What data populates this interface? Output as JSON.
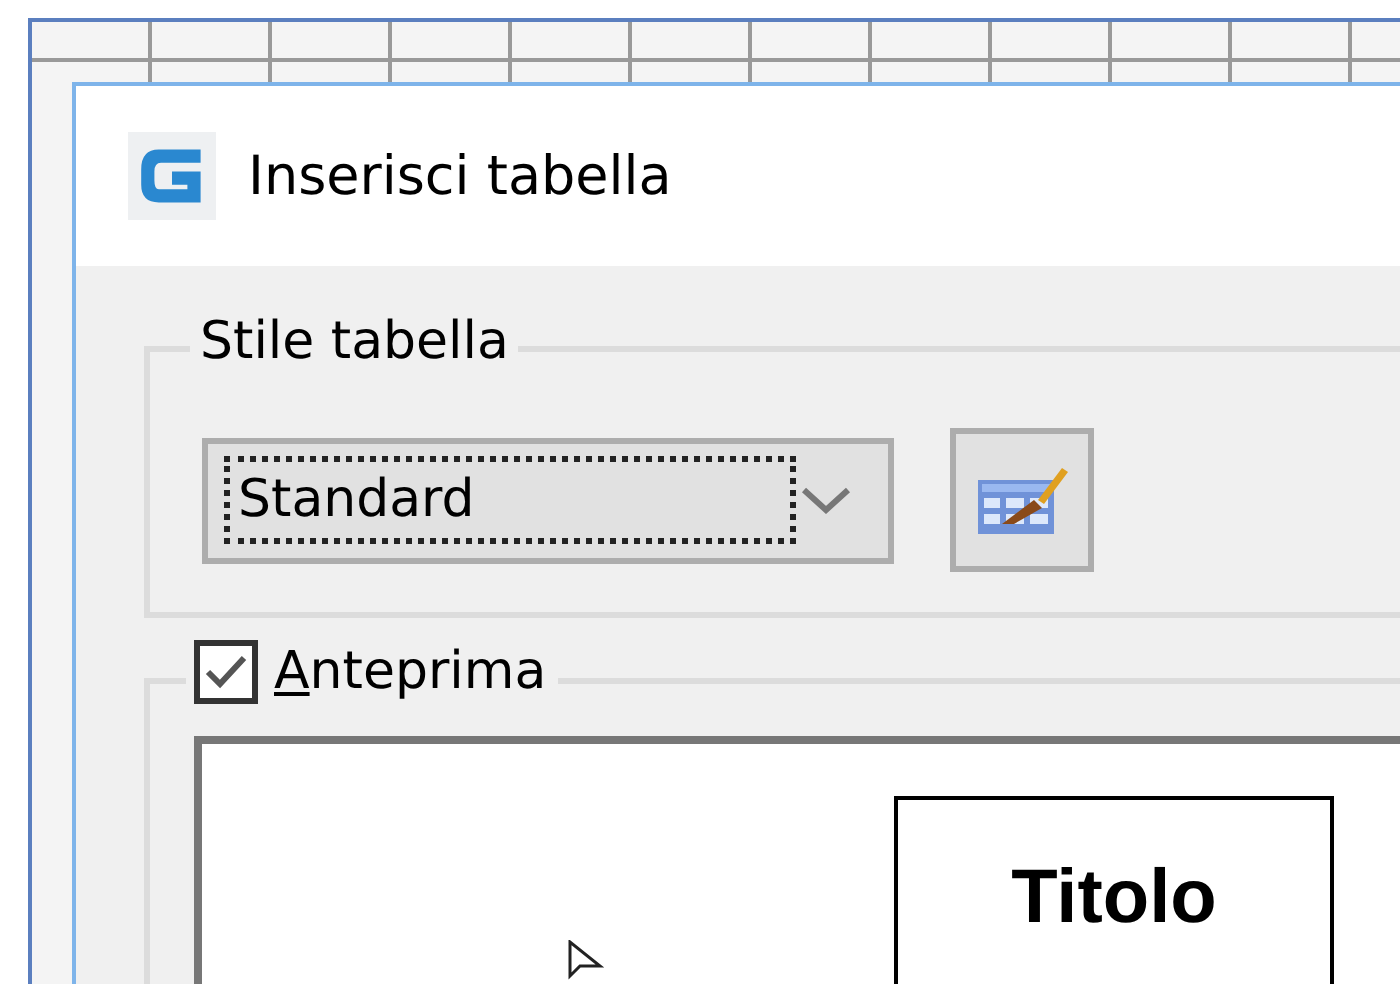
{
  "window": {
    "title": "Inserisci tabella"
  },
  "table_style": {
    "label": "Stile tabella",
    "dropdown": {
      "value": "Standard",
      "focused": true
    }
  },
  "preview": {
    "label": "Anteprima",
    "checked": true,
    "table_title": "Titolo"
  }
}
